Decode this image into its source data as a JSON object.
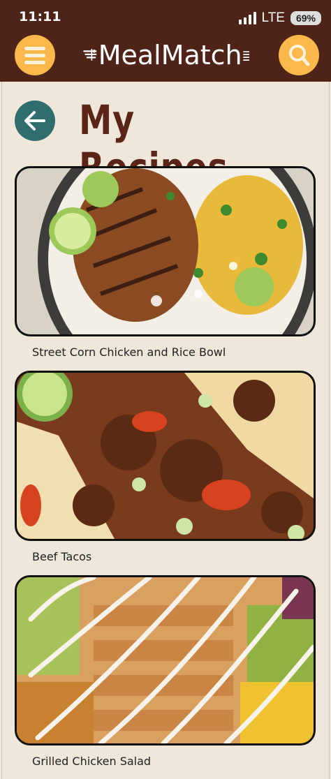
{
  "status_bar": {
    "time": "11:11",
    "network": "LTE",
    "battery": "69%"
  },
  "header": {
    "app_name": "MealMatch",
    "menu_icon": "hamburger-menu-icon",
    "search_icon": "magnifier-icon"
  },
  "page": {
    "title": "My Recipes",
    "back_icon": "arrow-left-icon"
  },
  "recipes": [
    {
      "name": "Street Corn Chicken and Rice Bowl"
    },
    {
      "name": "Beef Tacos"
    },
    {
      "name": "Grilled Chicken Salad"
    }
  ],
  "colors": {
    "header_bg": "#4f2418",
    "accent_orange": "#fbb84b",
    "back_teal": "#2f6e6c",
    "title_brown": "#5a2417",
    "page_bg": "#efe7da"
  }
}
